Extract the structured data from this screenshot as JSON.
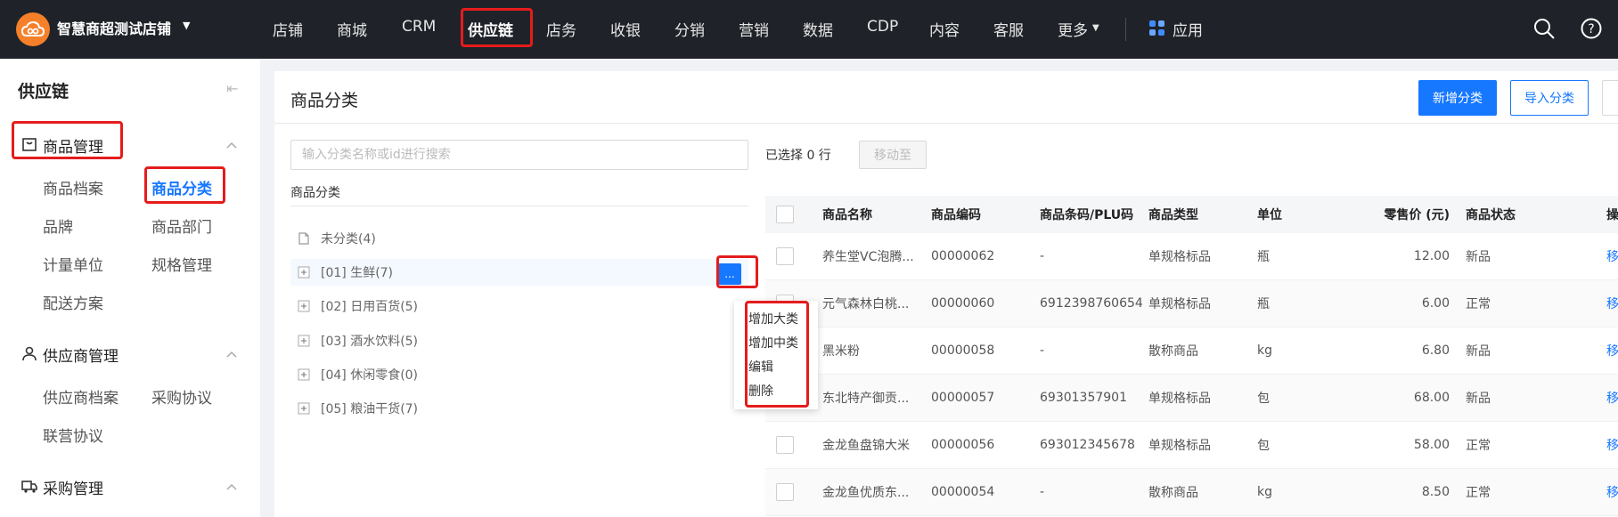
{
  "topbar": {
    "store_name": "智慧商超测试店铺",
    "nav": [
      "店铺",
      "商城",
      "CRM",
      "供应链",
      "店务",
      "收银",
      "分销",
      "营销",
      "数据",
      "CDP",
      "内容",
      "客服",
      "更多"
    ],
    "apps_label": "应用"
  },
  "sidebar": {
    "title": "供应链",
    "goods_group": "商品管理",
    "goods_items": [
      "商品档案",
      "商品分类",
      "品牌",
      "商品部门",
      "计量单位",
      "规格管理",
      "配送方案"
    ],
    "supplier_group": "供应商管理",
    "supplier_items": [
      "供应商档案",
      "采购协议",
      "联营协议"
    ],
    "purchase_group": "采购管理"
  },
  "main": {
    "title": "商品分类",
    "btn_add": "新增分类",
    "btn_import": "导入分类",
    "search_placeholder": "输入分类名称或id进行搜索",
    "tree_label": "商品分类",
    "tree": [
      "未分类(4)",
      "[01] 生鲜(7)",
      "[02] 日用百货(5)",
      "[03] 酒水饮料(5)",
      "[04] 休闲零食(0)",
      "[05] 粮油干货(7)"
    ],
    "more_btn": "...",
    "context_menu": [
      "增加大类",
      "增加中类",
      "编辑",
      "删除"
    ],
    "selected_text": "已选择 0 行",
    "move_btn": "移动至"
  },
  "table": {
    "columns": [
      "商品名称",
      "商品编码",
      "商品条码/PLU码",
      "商品类型",
      "单位",
      "零售价 (元)",
      "商品状态",
      "操"
    ],
    "rows": [
      [
        "养生堂VC泡腾...",
        "00000062",
        "-",
        "单规格标品",
        "瓶",
        "12.00",
        "新品",
        "移"
      ],
      [
        "元气森林白桃...",
        "00000060",
        "6912398760654",
        "单规格标品",
        "瓶",
        "6.00",
        "正常",
        "移"
      ],
      [
        "黑米粉",
        "00000058",
        "-",
        "散称商品",
        "kg",
        "6.80",
        "新品",
        "移"
      ],
      [
        "东北特产御贡...",
        "00000057",
        "69301357901",
        "单规格标品",
        "包",
        "68.00",
        "新品",
        "移"
      ],
      [
        "金龙鱼盘锦大米",
        "00000056",
        "693012345678",
        "单规格标品",
        "包",
        "58.00",
        "正常",
        "移"
      ],
      [
        "金龙鱼优质东...",
        "00000054",
        "-",
        "散称商品",
        "kg",
        "8.50",
        "正常",
        "移"
      ]
    ]
  }
}
